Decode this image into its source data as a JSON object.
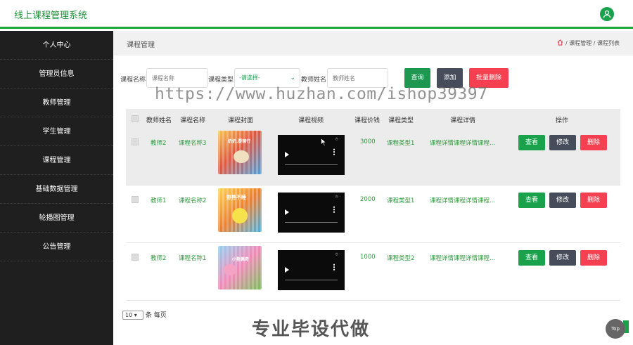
{
  "app": {
    "title": "线上课程管理系统"
  },
  "sidebar": {
    "items": [
      {
        "label": "个人中心"
      },
      {
        "label": "管理员信息"
      },
      {
        "label": "教师管理"
      },
      {
        "label": "学生管理"
      },
      {
        "label": "课程管理"
      },
      {
        "label": "基础数据管理"
      },
      {
        "label": "轮播图管理"
      },
      {
        "label": "公告管理"
      }
    ]
  },
  "header": {
    "page_title": "课程管理",
    "breadcrumb": [
      "课程管理",
      "课程列表"
    ],
    "separator": "/"
  },
  "search": {
    "course_name_label": "课程名称",
    "course_name_placeholder": "课程名称",
    "course_type_label": "课程类型",
    "course_type_value": "-请选择-",
    "teacher_name_label": "教师姓名",
    "teacher_name_placeholder": "教师姓名",
    "query_label": "查询",
    "add_label": "添加",
    "batch_delete_label": "批量删除"
  },
  "watermark": "https://www.huzhan.com/ishop39397",
  "table": {
    "headers": [
      "教师姓名",
      "课程名称",
      "课程封面",
      "课程视频",
      "课程价钱",
      "课程类型",
      "课程详情",
      "操作"
    ],
    "rows": [
      {
        "teacher": "教师2",
        "course": "课程名称3",
        "price": "3000",
        "type": "课程类型1",
        "detail": "课程详情课程详情课程...",
        "cover_text": "奶奶.要骑行"
      },
      {
        "teacher": "教师1",
        "course": "课程名称2",
        "price": "2000",
        "type": "课程类型1",
        "detail": "课程详情课程详情课程...",
        "cover_text": "野熊不睡"
      },
      {
        "teacher": "教师2",
        "course": "课程名称1",
        "price": "1000",
        "type": "课程类型2",
        "detail": "课程详情课程详情课程...",
        "cover_text": "小猪佩奇"
      }
    ],
    "view_label": "查看",
    "edit_label": "修改",
    "delete_label": "删除"
  },
  "pagination": {
    "page_size": "10",
    "suffix": "条 每页"
  },
  "promo": "专业毕设代做",
  "back_to_top": "Top",
  "colors": {
    "accent": "#1aa14b",
    "dark_button": "#474c5b",
    "danger": "#f44050",
    "sidebar": "#1e1f1e"
  }
}
